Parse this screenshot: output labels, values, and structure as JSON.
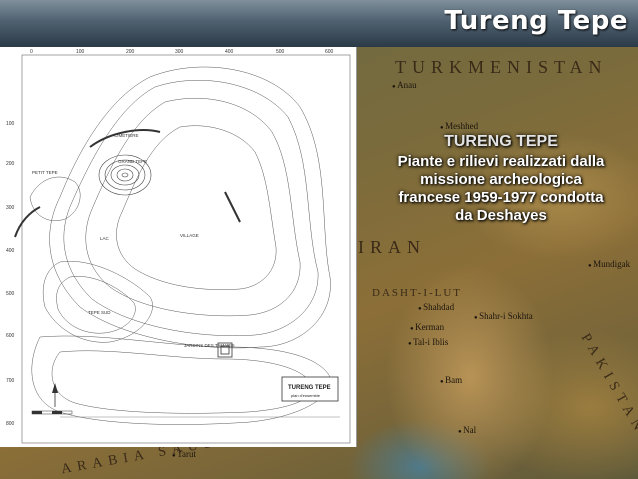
{
  "slide": {
    "header_title": "Tureng Tepe",
    "caption_title": "TURENG TEPE",
    "caption_body": "Piante e rilievi realizzati dalla missione archeologica francese 1959-1977 condotta da Deshayes"
  },
  "map": {
    "countries": [
      "TURKMENISTAN",
      "IRAN",
      "DASHT-I-LUT",
      "PAKISTAN",
      "ARABIA SAUDITA"
    ],
    "cities": [
      "Anau",
      "Meshhed",
      "Shahdad",
      "Kerman",
      "Tal-i Iblis",
      "Bam",
      "Mundigak",
      "Shahr-i Sokhta",
      "Tarut",
      "Nal"
    ]
  },
  "plan": {
    "x_ticks": [
      "0",
      "100",
      "200",
      "300",
      "400",
      "500",
      "600"
    ],
    "y_ticks": [
      "100",
      "200",
      "300",
      "400",
      "500",
      "600",
      "700",
      "800"
    ],
    "labels": [
      "CIMETIERE",
      "GRAND TEPE",
      "PETIT TEPE",
      "LAC",
      "VILLAGE",
      "TEPE SUD",
      "JARDINS DES TAMARIS"
    ],
    "legend_title": "TURENG TEPE",
    "legend_subtitle": "plan d'ensemble"
  }
}
